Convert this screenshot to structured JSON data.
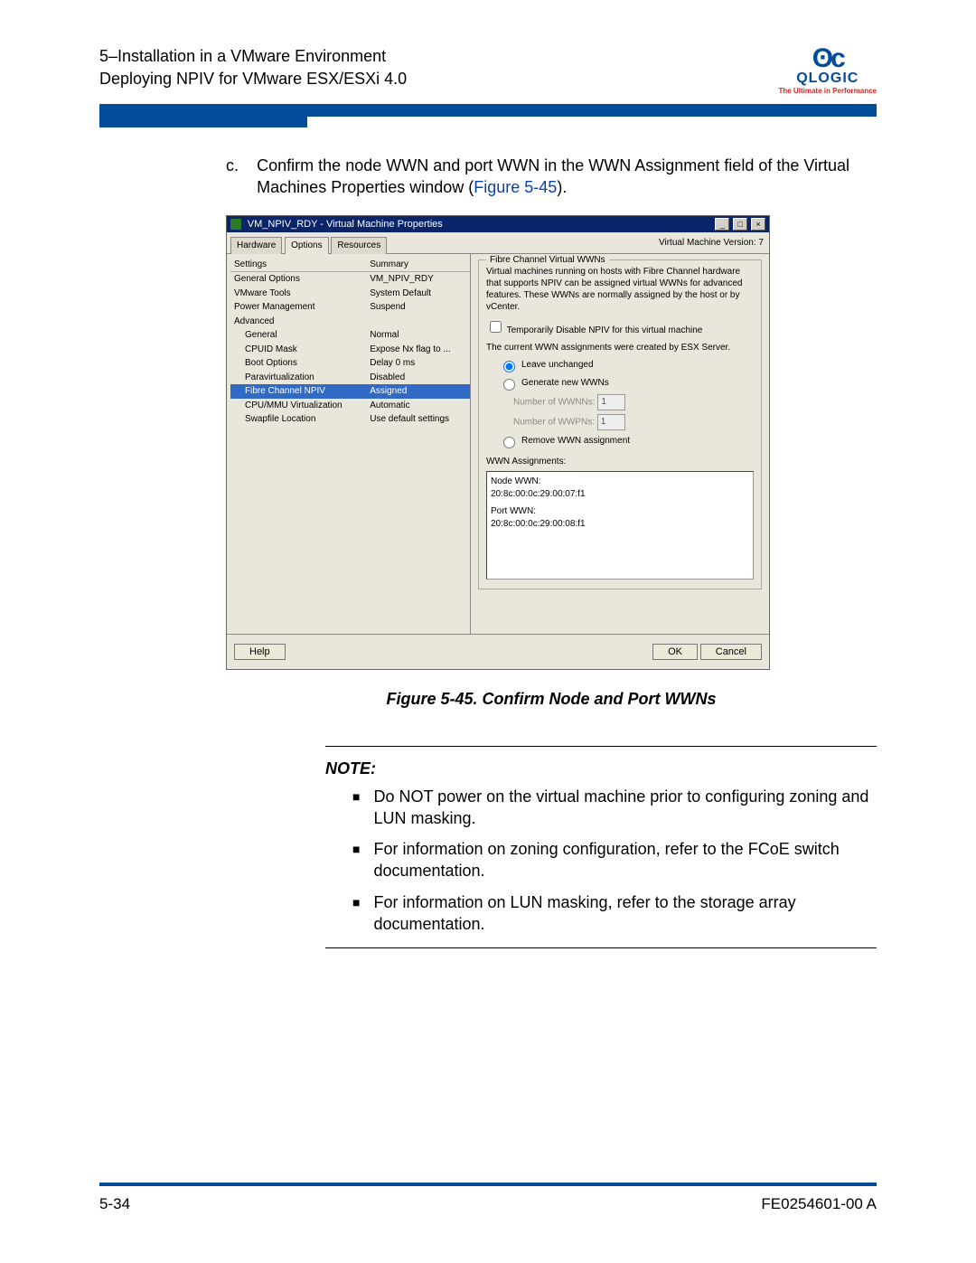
{
  "header": {
    "line1": "5–Installation in a VMware Environment",
    "line2": "Deploying NPIV for VMware ESX/ESXi 4.0",
    "logo_brand": "QLOGIC",
    "logo_tagline": "The Ultimate in Performance"
  },
  "step": {
    "label": "c.",
    "text_before": "Confirm the node WWN and port WWN in the WWN Assignment field of the Virtual Machines Properties window (",
    "fig_ref": "Figure 5-45",
    "text_after": ")."
  },
  "dialog": {
    "title": "VM_NPIV_RDY - Virtual Machine Properties",
    "version": "Virtual Machine Version: 7",
    "tabs": [
      "Hardware",
      "Options",
      "Resources"
    ],
    "active_tab": 1,
    "left_header": [
      "Settings",
      "Summary"
    ],
    "left_rows": [
      {
        "name": "General Options",
        "summary": "VM_NPIV_RDY",
        "indent": 0
      },
      {
        "name": "VMware Tools",
        "summary": "System Default",
        "indent": 0
      },
      {
        "name": "Power Management",
        "summary": "Suspend",
        "indent": 0
      },
      {
        "name": "Advanced",
        "summary": "",
        "indent": 0
      },
      {
        "name": "General",
        "summary": "Normal",
        "indent": 1
      },
      {
        "name": "CPUID Mask",
        "summary": "Expose Nx flag to ...",
        "indent": 1
      },
      {
        "name": "Boot Options",
        "summary": "Delay 0 ms",
        "indent": 1
      },
      {
        "name": "Paravirtualization",
        "summary": "Disabled",
        "indent": 1
      },
      {
        "name": "Fibre Channel NPIV",
        "summary": "Assigned",
        "indent": 1,
        "selected": true
      },
      {
        "name": "CPU/MMU Virtualization",
        "summary": "Automatic",
        "indent": 1
      },
      {
        "name": "Swapfile Location",
        "summary": "Use default settings",
        "indent": 1
      }
    ],
    "right": {
      "group1_title": "Fibre Channel Virtual WWNs",
      "desc": "Virtual machines running on hosts with Fibre Channel hardware that supports NPIV can be assigned virtual WWNs for advanced features. These WWNs are normally assigned by the host or by vCenter.",
      "disable_chk": "Temporarily Disable NPIV for this virtual machine",
      "status": "The current WWN assignments were created by ESX Server.",
      "radio_leave": "Leave unchanged",
      "radio_generate": "Generate new WWNs",
      "num_wwnn_label": "Number of WWNNs:",
      "num_wwnn_value": "1",
      "num_wwpn_label": "Number of WWPNs:",
      "num_wwpn_value": "1",
      "radio_remove": "Remove WWN assignment",
      "assignments_label": "WWN Assignments:",
      "node_label": "Node WWN:",
      "node_value": "20:8c:00:0c:29:00:07:f1",
      "port_label": "Port WWN:",
      "port_value": "20:8c:00:0c:29:00:08:f1"
    },
    "buttons": {
      "help": "Help",
      "ok": "OK",
      "cancel": "Cancel"
    }
  },
  "caption": "Figure 5-45. Confirm Node and Port WWNs",
  "note": {
    "heading": "NOTE:",
    "items": [
      "Do NOT power on the virtual machine prior to configuring zoning and LUN masking.",
      "For information on zoning configuration, refer to the FCoE switch documentation.",
      "For information on LUN masking, refer to the storage array documentation."
    ]
  },
  "footer": {
    "page": "5-34",
    "doc": "FE0254601-00 A"
  }
}
